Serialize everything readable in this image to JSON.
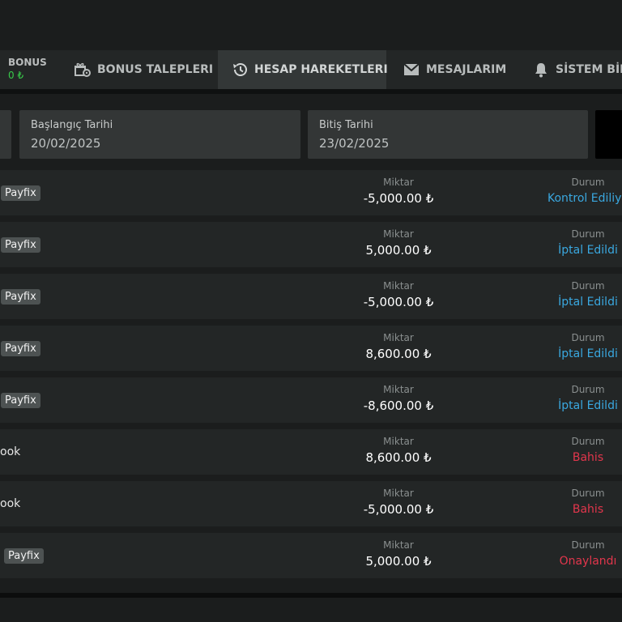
{
  "header": {
    "bonus_label": "BONUS",
    "bonus_value": "0 ₺"
  },
  "tabs": [
    {
      "label": "BONUS TALEPLERI",
      "icon": "gift-gear-icon"
    },
    {
      "label": "HESAP HAREKETLERI",
      "icon": "history-icon",
      "active": true
    },
    {
      "label": "MESAJLARIM",
      "icon": "envelope-icon"
    },
    {
      "label": "SİSTEM BİLD",
      "icon": "bell-icon"
    }
  ],
  "filters": {
    "start_label": "Başlangıç Tarihi",
    "start_value": "20/02/2025",
    "end_label": "Bitiş Tarihi",
    "end_value": "23/02/2025"
  },
  "colors": {
    "blue_status": "#3aa8e0",
    "red_status": "#e2364c",
    "bonus_green": "#38c94a"
  },
  "rows": [
    {
      "method": "Payfix",
      "amount_label": "Miktar",
      "amount": "-5,000.00 ₺",
      "status_label": "Durum",
      "status": "Kontrol Ediliyo"
    },
    {
      "method": "Payfix",
      "amount_label": "Miktar",
      "amount": "5,000.00 ₺",
      "status_label": "Durum",
      "status": "İptal Edildi"
    },
    {
      "method": "Payfix",
      "amount_label": "Miktar",
      "amount": "-5,000.00 ₺",
      "status_label": "Durum",
      "status": "İptal Edildi"
    },
    {
      "method": "Payfix",
      "amount_label": "Miktar",
      "amount": "8,600.00 ₺",
      "status_label": "Durum",
      "status": "İptal Edildi"
    },
    {
      "method": "Payfix",
      "amount_label": "Miktar",
      "amount": "-8,600.00 ₺",
      "status_label": "Durum",
      "status": "İptal Edildi"
    },
    {
      "method": "ook",
      "amount_label": "Miktar",
      "amount": "8,600.00 ₺",
      "status_label": "Durum",
      "status": "Bahis"
    },
    {
      "method": "ook",
      "amount_label": "Miktar",
      "amount": "-5,000.00 ₺",
      "status_label": "Durum",
      "status": "Bahis"
    },
    {
      "method": "Payfix",
      "amount_label": "Miktar",
      "amount": "5,000.00 ₺",
      "status_label": "Durum",
      "status": "Onaylandı"
    }
  ]
}
